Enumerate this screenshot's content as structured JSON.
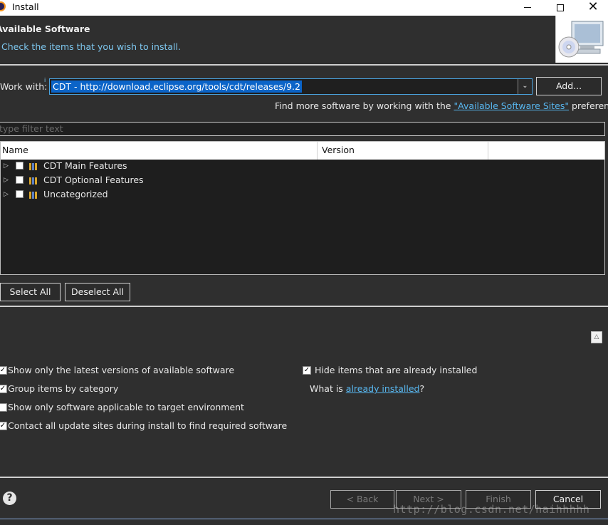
{
  "window": {
    "title": "Install",
    "minimize_icon": "minimize-icon",
    "maximize_icon": "maximize-icon",
    "close_glyph": "✕"
  },
  "header": {
    "title": "Available Software",
    "subtitle": "Check the items that you wish to install."
  },
  "work_with": {
    "label": "Work with:",
    "value": "CDT - http://download.eclipse.org/tools/cdt/releases/9.2",
    "add_button": "Add...",
    "find_more_prefix": "Find more software by working with the ",
    "find_more_link": "\"Available Software Sites\"",
    "find_more_suffix": " preferences."
  },
  "filter": {
    "placeholder": "type filter text"
  },
  "table": {
    "columns": [
      "Name",
      "Version",
      ""
    ],
    "rows": [
      {
        "label": "CDT Main Features",
        "checked": false
      },
      {
        "label": "CDT Optional Features",
        "checked": false
      },
      {
        "label": "Uncategorized",
        "checked": false
      }
    ]
  },
  "selection_buttons": {
    "select_all": "Select All",
    "deselect_all": "Deselect All"
  },
  "options": {
    "show_latest": {
      "label": "Show only the latest versions of available software",
      "checked": true
    },
    "group_by_category": {
      "label": "Group items by category",
      "checked": true
    },
    "show_applicable": {
      "label": "Show only software applicable to target environment",
      "checked": false
    },
    "contact_sites": {
      "label": "Contact all update sites during install to find required software",
      "checked": true
    },
    "hide_installed": {
      "label": "Hide items that are already installed",
      "checked": true
    },
    "what_is_prefix": "What is ",
    "what_is_link": "already installed",
    "what_is_suffix": "?"
  },
  "footer": {
    "help": "?",
    "back": "< Back",
    "next": "Next >",
    "finish": "Finish",
    "cancel": "Cancel"
  },
  "watermark": "http://blog.csdn.net/haihhhhh",
  "colors": {
    "accent": "#0b64c8",
    "link": "#58b7f0",
    "background": "#2f2f2f"
  }
}
